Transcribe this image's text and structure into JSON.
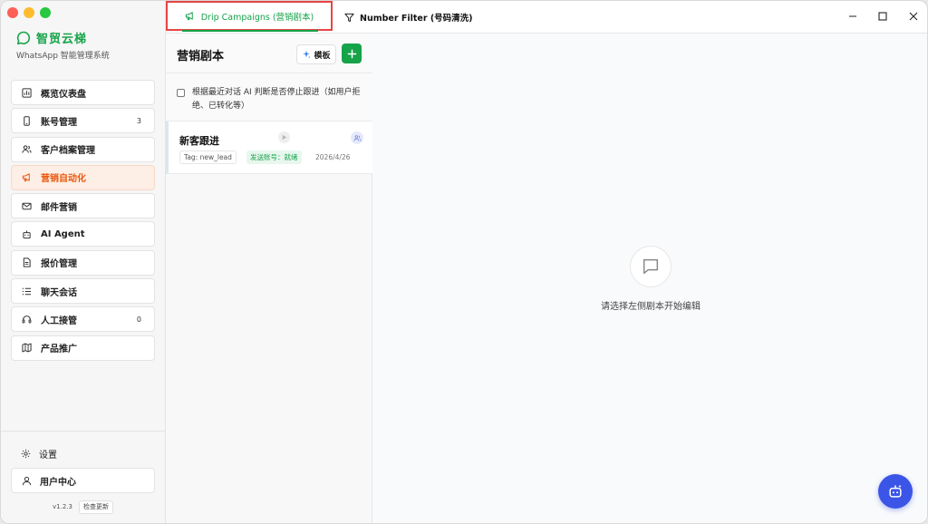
{
  "app": {
    "brand_name": "智贸云梯",
    "brand_sub": "WhatsApp 智能管理系统",
    "accent": "#16a34a",
    "active_color": "#ea580c"
  },
  "sidebar": {
    "items": [
      {
        "label": "概览仪表盘",
        "icon": "dashboard-icon",
        "count": ""
      },
      {
        "label": "账号管理",
        "icon": "phone-icon",
        "count": "3"
      },
      {
        "label": "客户档案管理",
        "icon": "users-icon",
        "count": ""
      },
      {
        "label": "营销自动化",
        "icon": "megaphone-icon",
        "count": "",
        "active": true
      },
      {
        "label": "邮件营销",
        "icon": "mail-icon",
        "count": ""
      },
      {
        "label": "AI Agent",
        "icon": "robot-icon",
        "count": ""
      },
      {
        "label": "报价管理",
        "icon": "document-icon",
        "count": ""
      },
      {
        "label": "聊天会话",
        "icon": "list-icon",
        "count": ""
      },
      {
        "label": "人工接管",
        "icon": "headset-icon",
        "count": "0"
      },
      {
        "label": "产品推广",
        "icon": "map-icon",
        "count": ""
      }
    ],
    "settings_label": "设置",
    "user_center_label": "用户中心",
    "version": "v1.2.3",
    "check_update": "检查更新"
  },
  "tabs": {
    "drip_label": "Drip Campaigns (营销剧本)",
    "number_filter_label": "Number Filter (号码清洗)"
  },
  "playbooks": {
    "title": "营销剧本",
    "template_button": "模板",
    "ai_stop_label": "根据最近对话 AI 判断是否停止跟进（如用户拒绝、已转化等）",
    "campaigns": [
      {
        "name": "新客跟进",
        "tag": "Tag: new_lead",
        "account": "发送账号：就绪",
        "date": "2026/4/26"
      }
    ]
  },
  "editor": {
    "empty_text": "请选择左侧剧本开始编辑"
  }
}
